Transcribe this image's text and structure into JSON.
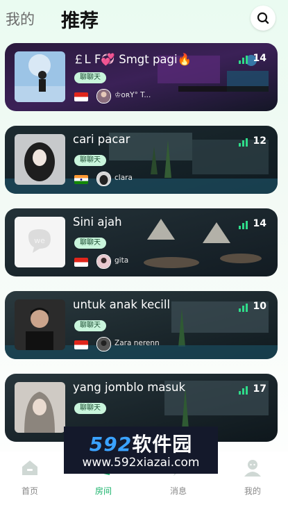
{
  "header": {
    "tab_mine": "我的",
    "tab_recommend": "推荐"
  },
  "rooms": [
    {
      "title": "￡L F💞 Smgt pagi🔥",
      "tag": "聊聊天",
      "host": "♔ᴏʀY° T...",
      "count": "14",
      "flag": "Indonesia"
    },
    {
      "title": "cari pacar",
      "tag": "聊聊天",
      "host": "clara",
      "count": "12",
      "flag": "India"
    },
    {
      "title": "Sini ajah",
      "tag": "聊聊天",
      "host": "gita",
      "count": "14",
      "flag": "Indonesia"
    },
    {
      "title": "untuk anak kecill",
      "tag": "聊聊天",
      "host": "Zara nerenn",
      "count": "10",
      "flag": "Indonesia"
    },
    {
      "title": "yang jomblo masuk",
      "tag": "聊聊天",
      "host": "",
      "count": "17",
      "flag": "Indonesia"
    }
  ],
  "thumb3_logo": "we",
  "nav": [
    {
      "label": "首页",
      "icon": "home-icon"
    },
    {
      "label": "房间",
      "icon": "room-icon"
    },
    {
      "label": "消息",
      "icon": "message-icon"
    },
    {
      "label": "我的",
      "icon": "profile-icon"
    }
  ],
  "watermark": {
    "line1_num": "592",
    "line1_cn": "软件园",
    "line2": "www.592xiazai.com"
  },
  "colors": {
    "accent": "#19b36b",
    "tag_bg": "#c9f5dc",
    "signal": "#2fdc8a"
  }
}
